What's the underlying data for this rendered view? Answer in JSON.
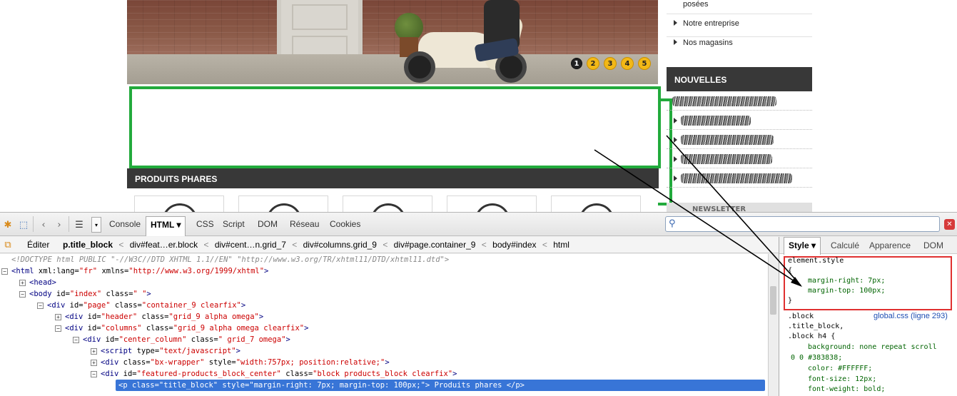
{
  "site": {
    "slider_pages": [
      "1",
      "2",
      "3",
      "4",
      "5"
    ],
    "active_page": "1",
    "section_title": "PRODUITS PHARES",
    "right_menu": [
      "posées",
      "Notre entreprise",
      "Nos magasins"
    ],
    "news_title": "NOUVELLES",
    "news_items_blurred": [
      "…échée",
      "",
      "S…e",
      "A…",
      "Gr…rage:"
    ],
    "newsletter_label": "NEWSLETTER"
  },
  "firebug": {
    "toolbar_tabs": [
      "Console",
      "HTML",
      "CSS",
      "Script",
      "DOM",
      "Réseau",
      "Cookies"
    ],
    "active_tab": "HTML",
    "html_dropdown_arrow": "▾",
    "search_placeholder": "",
    "edit_label": "Éditer",
    "breadcrumbs": [
      "p.title_block",
      "div#feat…er.block",
      "div#cent…n.grid_7",
      "div#columns.grid_9",
      "div#page.container_9",
      "body#index",
      "html"
    ],
    "breadcrumb_sep": "<",
    "html_lines": [
      {
        "indent": 0,
        "expander": "",
        "text": "<!DOCTYPE html PUBLIC \"-//W3C//DTD XHTML 1.1//EN\" \"http://www.w3.org/TR/xhtml11/DTD/xhtml11.dtd\">",
        "kind": "doctype"
      },
      {
        "indent": 0,
        "expander": "−",
        "tag": "html",
        "attrs": [
          [
            "xml:lang",
            "fr"
          ],
          [
            "xmlns",
            "http://www.w3.org/1999/xhtml"
          ]
        ],
        "close": ">"
      },
      {
        "indent": 1,
        "expander": "+",
        "tag": "head",
        "attrs": [],
        "close": ">"
      },
      {
        "indent": 1,
        "expander": "−",
        "tag": "body",
        "attrs": [
          [
            "id",
            "index"
          ],
          [
            "class",
            " "
          ]
        ],
        "close": ">"
      },
      {
        "indent": 2,
        "expander": "−",
        "tag": "div",
        "attrs": [
          [
            "id",
            "page"
          ],
          [
            "class",
            "container_9 clearfix"
          ]
        ],
        "close": ">"
      },
      {
        "indent": 3,
        "expander": "+",
        "tag": "div",
        "attrs": [
          [
            "id",
            "header"
          ],
          [
            "class",
            "grid_9 alpha omega"
          ]
        ],
        "close": ">"
      },
      {
        "indent": 3,
        "expander": "−",
        "tag": "div",
        "attrs": [
          [
            "id",
            "columns"
          ],
          [
            "class",
            "grid_9 alpha omega clearfix"
          ]
        ],
        "close": ">"
      },
      {
        "indent": 4,
        "expander": "−",
        "tag": "div",
        "attrs": [
          [
            "id",
            "center_column"
          ],
          [
            "class",
            " grid_7 omega"
          ]
        ],
        "close": ">"
      },
      {
        "indent": 5,
        "expander": "+",
        "tag": "script",
        "attrs": [
          [
            "type",
            "text/javascript"
          ]
        ],
        "close": ">"
      },
      {
        "indent": 5,
        "expander": "+",
        "tag": "div",
        "attrs": [
          [
            "class",
            "bx-wrapper"
          ],
          [
            "style",
            "width:757px; position:relative;"
          ]
        ],
        "close": ">"
      },
      {
        "indent": 5,
        "expander": "−",
        "tag": "div",
        "attrs": [
          [
            "id",
            "featured-products_block_center"
          ],
          [
            "class",
            "block products_block clearfix"
          ]
        ],
        "close": ">"
      },
      {
        "indent": 6,
        "expander": "",
        "tag": "p",
        "attrs": [
          [
            "class",
            "title_block"
          ],
          [
            "style",
            "margin-right: 7px; margin-top: 100px;"
          ]
        ],
        "close": ">",
        "content": "Produits phares",
        "endtag": "</p>",
        "selected": true
      }
    ],
    "side_tabs": [
      "Style",
      "Calculé",
      "Apparence",
      "DOM"
    ],
    "active_side_tab": "Style",
    "css_rules": [
      {
        "text": "element.style",
        "kind": "sel"
      },
      {
        "text": "{",
        "kind": "brace"
      },
      {
        "text": "margin-right: 7px;",
        "kind": "prop"
      },
      {
        "text": "margin-top: 100px;",
        "kind": "prop"
      },
      {
        "text": "}",
        "kind": "brace"
      },
      {
        "text": ".block",
        "kind": "sel",
        "source": "global.css (ligne 293)"
      },
      {
        "text": ".title_block,",
        "kind": "sel"
      },
      {
        "text": ".block h4 {",
        "kind": "sel"
      },
      {
        "text": "background: none repeat scroll",
        "kind": "prop"
      },
      {
        "text": "0 0 #383838;",
        "kind": "prop"
      },
      {
        "text": "color: #FFFFFF;",
        "kind": "prop"
      },
      {
        "text": "font-size: 12px;",
        "kind": "prop"
      },
      {
        "text": "font-weight: bold;",
        "kind": "prop"
      }
    ]
  }
}
